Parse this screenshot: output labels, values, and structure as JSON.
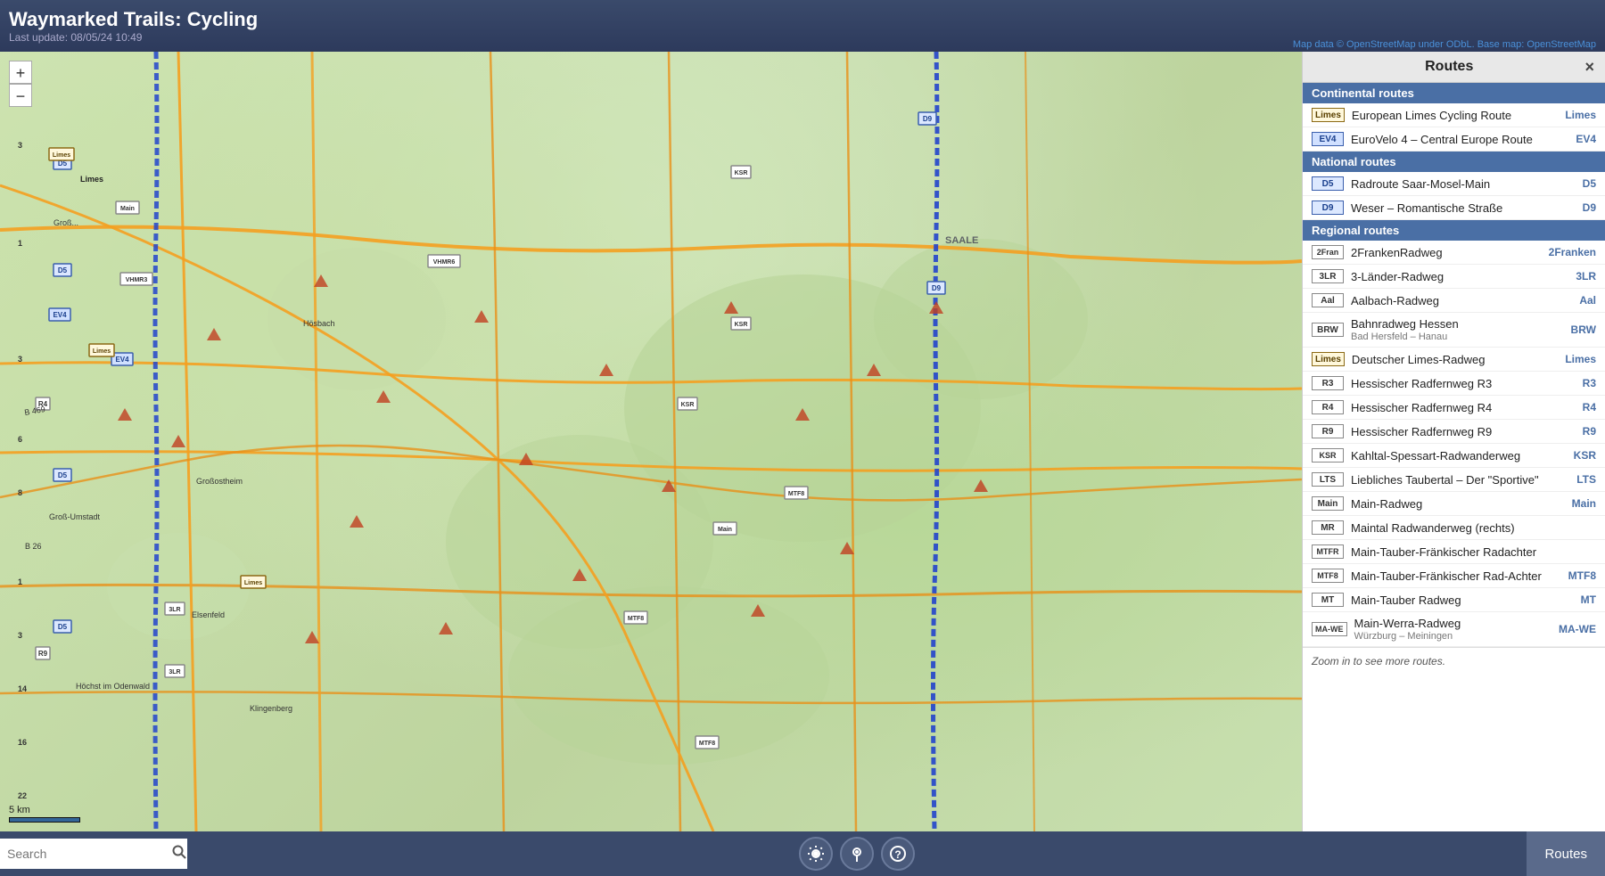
{
  "app": {
    "title": "Waymarked Trails: Cycling",
    "last_update_label": "Last update: 08/05/24 10:49"
  },
  "attribution": {
    "text": "Map data © OpenStreetMap under ODbL. Base map: OpenStreetMap"
  },
  "routes_panel": {
    "title": "Routes",
    "close_label": "×",
    "zoom_hint": "Zoom in to see more routes.",
    "sections": [
      {
        "name": "Continental routes",
        "items": [
          {
            "badge": "Limes",
            "badge_class": "badge-limes",
            "name": "European Limes Cycling Route",
            "short": "Limes"
          },
          {
            "badge": "EV4",
            "badge_class": "badge-ev4",
            "name": "EuroVelo 4 – Central Europe Route",
            "short": "EV4"
          }
        ]
      },
      {
        "name": "National routes",
        "items": [
          {
            "badge": "D5",
            "badge_class": "badge-d5",
            "name": "Radroute Saar-Mosel-Main",
            "short": "D5"
          },
          {
            "badge": "D9",
            "badge_class": "badge-d9",
            "name": "Weser – Romantische Straße",
            "short": "D9"
          }
        ]
      },
      {
        "name": "Regional routes",
        "items": [
          {
            "badge": "2Fran",
            "badge_class": "badge-2fran",
            "name": "2FrankenRadweg",
            "short": "2Franken"
          },
          {
            "badge": "3LR",
            "badge_class": "badge-3lr",
            "name": "3-Länder-Radweg",
            "short": "3LR"
          },
          {
            "badge": "Aal",
            "badge_class": "badge-aal",
            "name": "Aalbach-Radweg",
            "short": "Aal"
          },
          {
            "badge": "BRW",
            "badge_class": "badge-brw",
            "name": "Bahnradweg Hessen",
            "sub": "Bad Hersfeld – Hanau",
            "short": "BRW"
          },
          {
            "badge": "Limes",
            "badge_class": "badge-limes",
            "name": "Deutscher Limes-Radweg",
            "short": "Limes"
          },
          {
            "badge": "R3",
            "badge_class": "badge-r3",
            "name": "Hessischer Radfernweg R3",
            "short": "R3"
          },
          {
            "badge": "R4",
            "badge_class": "badge-r4",
            "name": "Hessischer Radfernweg R4",
            "short": "R4"
          },
          {
            "badge": "R9",
            "badge_class": "badge-r9",
            "name": "Hessischer Radfernweg R9",
            "short": "R9"
          },
          {
            "badge": "KSR",
            "badge_class": "badge-ksr",
            "name": "Kahltal-Spessart-Radwanderweg",
            "short": "KSR"
          },
          {
            "badge": "LTS",
            "badge_class": "badge-lts",
            "name": "Liebliches Taubertal – Der \"Sportive\"",
            "short": "LTS"
          },
          {
            "badge": "Main",
            "badge_class": "badge-main",
            "name": "Main-Radweg",
            "short": "Main"
          },
          {
            "badge": "MR",
            "badge_class": "badge-mr",
            "name": "Maintal Radwanderweg (rechts)",
            "short": ""
          },
          {
            "badge": "MTFR",
            "badge_class": "badge-mtfr",
            "name": "Main-Tauber-Fränkischer Radachter",
            "short": ""
          },
          {
            "badge": "MTF8",
            "badge_class": "badge-mtf8",
            "name": "Main-Tauber-Fränkischer Rad-Achter",
            "short": "MTF8"
          },
          {
            "badge": "MT",
            "badge_class": "badge-mt",
            "name": "Main-Tauber Radweg",
            "short": "MT"
          },
          {
            "badge": "MA-WE",
            "badge_class": "badge-mawe",
            "name": "Main-Werra-Radweg",
            "sub": "Würzburg – Meiningen",
            "short": "MA-WE"
          }
        ]
      }
    ]
  },
  "toolbar": {
    "search_placeholder": "Search",
    "search_label": "Search",
    "gear_label": "Settings",
    "pin_label": "Location",
    "help_label": "Help",
    "routes_label": "Routes"
  },
  "zoom_controls": {
    "zoom_in": "+",
    "zoom_out": "−"
  },
  "scale": {
    "label": "5 km"
  }
}
